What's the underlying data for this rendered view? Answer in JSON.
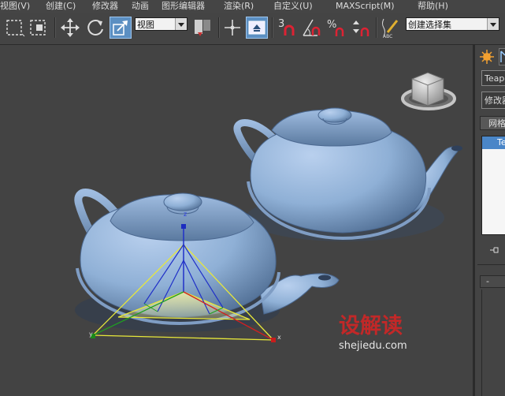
{
  "menu": {
    "items": [
      "视图(V)",
      "创建(C)",
      "修改器",
      "动画",
      "图形编辑器",
      "渲染(R)",
      "自定义(U)",
      "MAXScript(M)",
      "帮助(H)"
    ]
  },
  "toolbar": {
    "view_dropdown": "视图",
    "snap_angle_label": "3",
    "selection_set_dropdown": "创建选择集"
  },
  "viewport": {
    "axis_x": "x",
    "axis_y": "y",
    "axis_z": "z",
    "watermark_brand": "设解读",
    "watermark_url": "shejiedu.com"
  },
  "command_panel": {
    "object_name": "Teapot",
    "modifier_list": "修改器列表",
    "section_button": "网格",
    "stack_item": "Teapot",
    "rollout_collapse": "-"
  },
  "colors": {
    "teapot": "#8fb0d6",
    "accent": "#5b8fc2",
    "viewport_bg": "#434343",
    "gizmo_yellow": "#e8e83a"
  }
}
